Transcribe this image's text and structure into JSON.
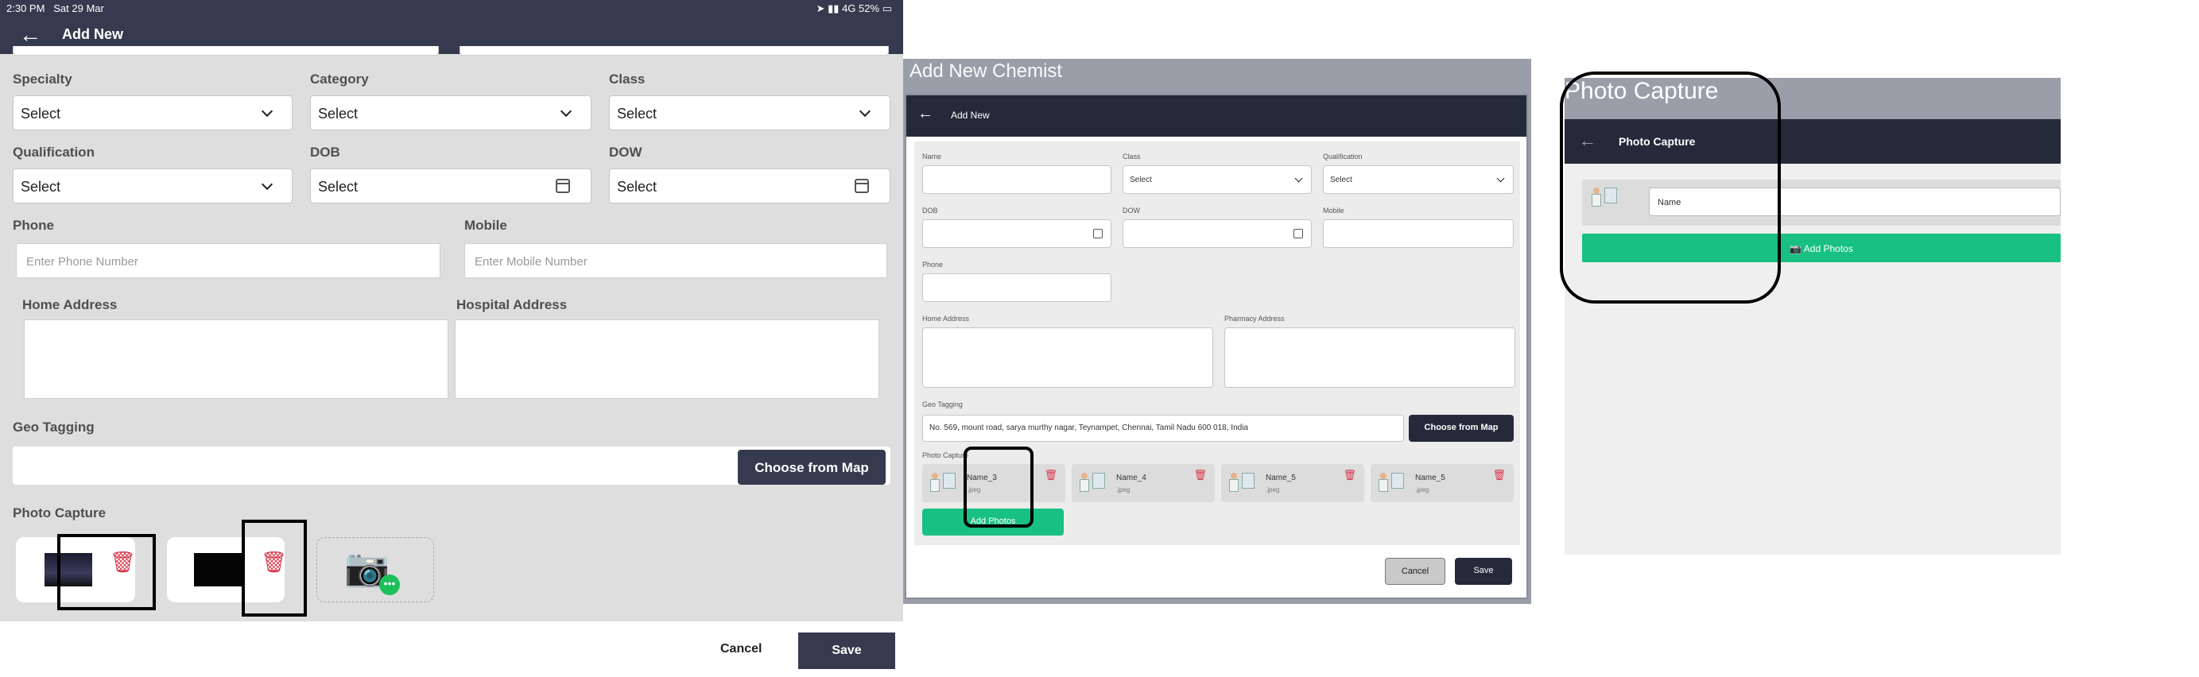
{
  "panel1": {
    "status": {
      "time": "2:30 PM",
      "date": "Sat 29 Mar",
      "signal": "4G",
      "battery": "52%"
    },
    "header": {
      "title": "Add New"
    },
    "fields": {
      "specialty": {
        "label": "Specialty",
        "value": "Select"
      },
      "category": {
        "label": "Category",
        "value": "Select"
      },
      "class": {
        "label": "Class",
        "value": "Select"
      },
      "qualification": {
        "label": "Qualification",
        "value": "Select"
      },
      "dob": {
        "label": "DOB",
        "value": "Select"
      },
      "dow": {
        "label": "DOW",
        "value": "Select"
      },
      "phone": {
        "label": "Phone",
        "placeholder": "Enter Phone Number"
      },
      "mobile": {
        "label": "Mobile",
        "placeholder": "Enter Mobile Number"
      },
      "home_address": {
        "label": "Home Address"
      },
      "hospital_address": {
        "label": "Hospital Address"
      },
      "geo_tagging": {
        "label": "Geo Tagging",
        "button": "Choose from Map"
      },
      "photo_capture": {
        "label": "Photo Capture"
      }
    },
    "footer": {
      "cancel": "Cancel",
      "save": "Save"
    }
  },
  "panel2": {
    "window_title": "Add New Chemist",
    "header": {
      "title": "Add New"
    },
    "fields": {
      "name": {
        "label": "Name"
      },
      "class": {
        "label": "Class",
        "value": "Select"
      },
      "qualification": {
        "label": "Qualification",
        "value": "Select"
      },
      "dob": {
        "label": "DOB"
      },
      "dow": {
        "label": "DOW"
      },
      "mobile": {
        "label": "Mobile"
      },
      "phone": {
        "label": "Phone"
      },
      "home_address": {
        "label": "Home Address"
      },
      "pharmacy_address": {
        "label": "Pharmacy Address"
      },
      "geo_tagging": {
        "label": "Geo Tagging",
        "value": "No. 569, mount road, sarya murthy nagar, Teynampet, Chennai, Tamil Nadu 600 018, India",
        "button": "Choose from Map"
      },
      "photo_capture": {
        "label": "Photo Capture"
      }
    },
    "photos": [
      {
        "name": "Name_3",
        "ext": ".jpeg"
      },
      {
        "name": "Name_4",
        "ext": ".jpeg"
      },
      {
        "name": "Name_5",
        "ext": ".jpeg"
      },
      {
        "name": "Name_5",
        "ext": ".jpeg"
      }
    ],
    "add_photos": "Add Photos",
    "footer": {
      "cancel": "Cancel",
      "save": "Save"
    }
  },
  "panel3": {
    "window_title": "Photo Capture",
    "header": {
      "title": "Photo Capture"
    },
    "name_value": "Name",
    "add_photos": "Add Photos"
  },
  "colors": {
    "header": "#363a4f",
    "accent_green": "#18c083",
    "delete_red": "#d9364a"
  }
}
